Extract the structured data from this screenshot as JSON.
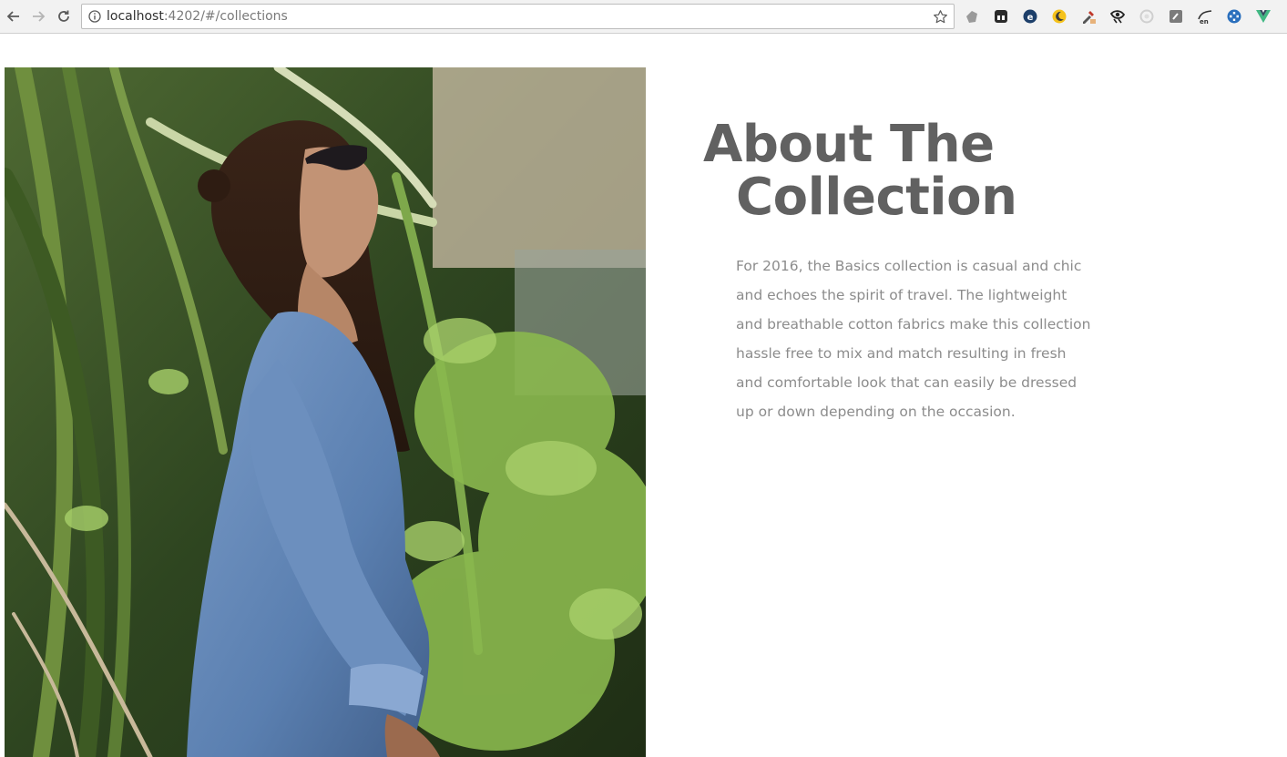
{
  "browser": {
    "url_host": "localhost",
    "url_rest": ":4202/#/collections",
    "extensions": [
      "extension-gray-shape-icon",
      "extension-tile-icon",
      "extension-e-badge-icon",
      "extension-moon-icon",
      "extension-eyedropper-icon",
      "extension-eye-icon",
      "extension-circle-icon",
      "extension-square-icon",
      "extension-en-icon",
      "extension-blue-badge-icon",
      "vue-devtools-icon"
    ]
  },
  "about": {
    "title_line1": "About The",
    "title_line2": "Collection",
    "description_lines": [
      "For 2016, the Basics collection is casual and chic",
      "and echoes the spirit of travel. The lightweight",
      "and breathable cotton fabrics make this collection",
      "hassle free to mix and match resulting in fresh",
      "and comfortable look that can easily be dressed",
      "up or down depending on the occasion."
    ]
  },
  "colors": {
    "title": "#616161",
    "body_text": "#8c8c8c",
    "background": "#ffffff"
  }
}
